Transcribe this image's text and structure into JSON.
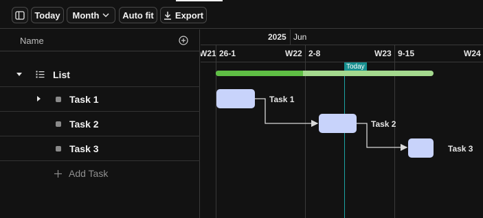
{
  "toolbar": {
    "sidebar_toggle_icon": "sidebar-icon",
    "today_label": "Today",
    "month_label": "Month",
    "chevron_icon": "chevron-down-icon",
    "autofit_label": "Auto fit",
    "export_icon": "download-icon",
    "export_label": "Export"
  },
  "name_column": {
    "header": "Name",
    "add_icon": "plus-circle-icon"
  },
  "rows": [
    {
      "label": "List",
      "kind": "group",
      "expanded": true,
      "icon": "list-icon"
    },
    {
      "label": "Task 1",
      "kind": "task",
      "expandable": true
    },
    {
      "label": "Task 2",
      "kind": "task"
    },
    {
      "label": "Task 3",
      "kind": "task"
    }
  ],
  "add_task": {
    "label": "Add Task",
    "icon": "plus-icon"
  },
  "timeline": {
    "year": "2025",
    "month": "Jun",
    "weeks": [
      {
        "label": "W21",
        "range": "26-1"
      },
      {
        "label": "W22",
        "range": "2-8"
      },
      {
        "label": "W23",
        "range": "9-15"
      },
      {
        "label": "W24",
        "range": ""
      }
    ],
    "today_label": "Today",
    "tasks": [
      {
        "name": "Task 1",
        "label": "Task 1"
      },
      {
        "name": "Task 2",
        "label": "Task 2"
      },
      {
        "name": "Task 3",
        "label": "Task 3"
      }
    ],
    "group_progress": 0.4
  },
  "colors": {
    "background": "#121212",
    "task_bar": "#c8d3fb",
    "progress_done": "#5fbf45",
    "progress_remaining": "#a4d98e",
    "today": "#1ca6a6"
  }
}
